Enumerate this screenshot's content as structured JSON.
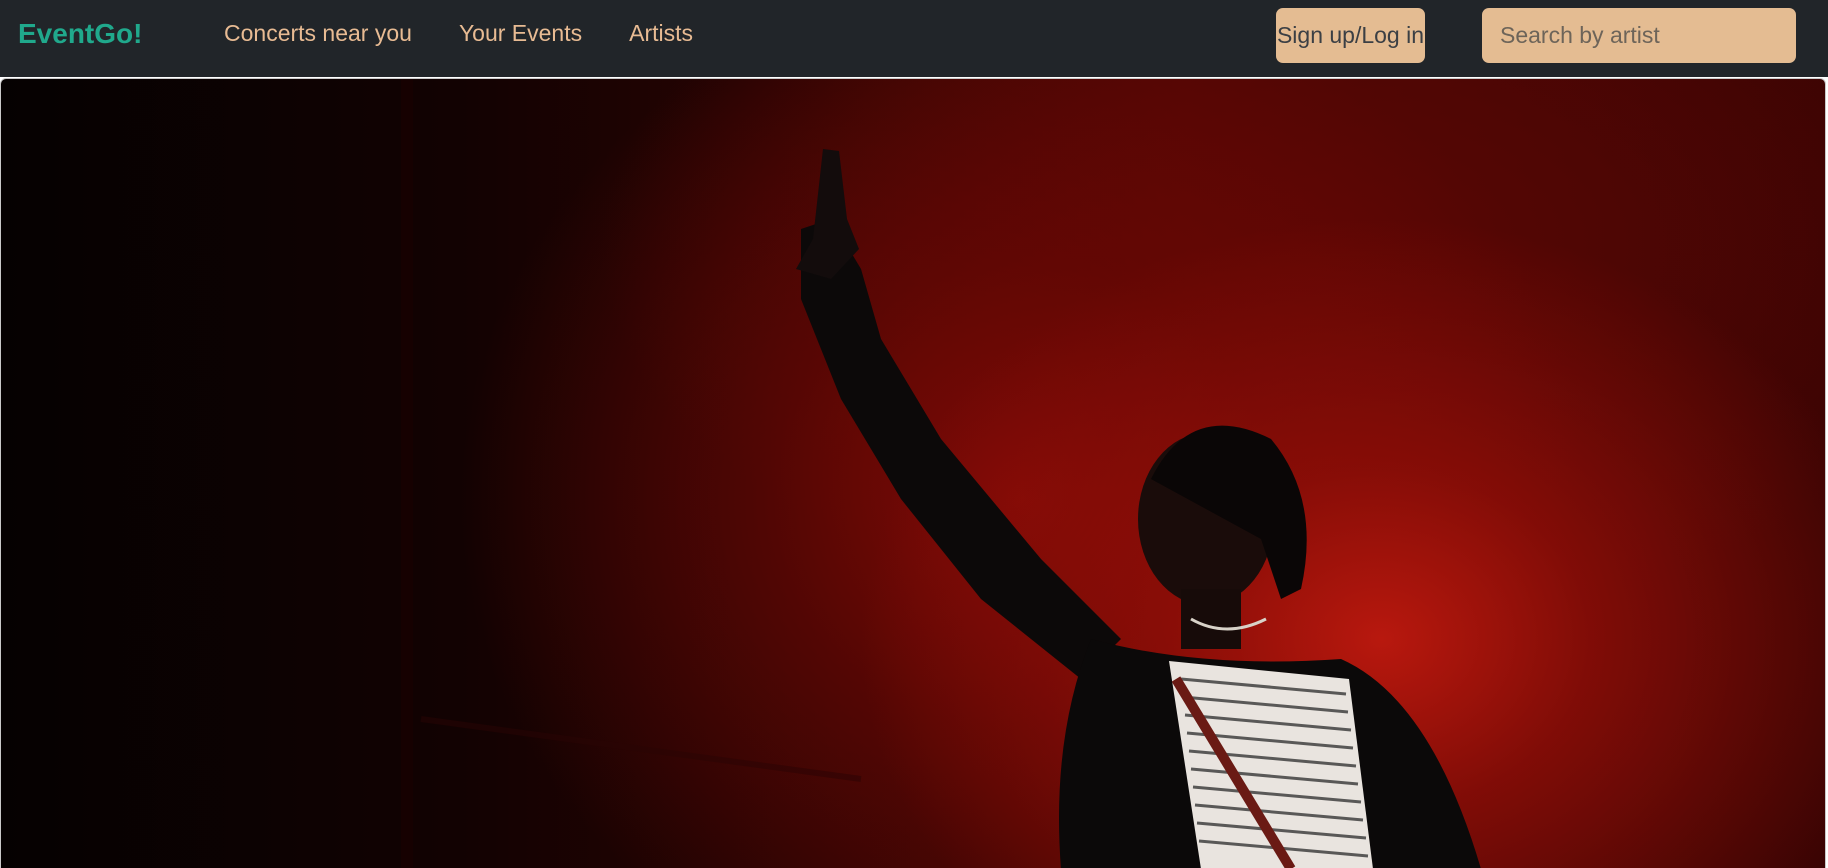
{
  "navbar": {
    "brand": "EventGo!",
    "links": [
      {
        "label": "Concerts near you"
      },
      {
        "label": "Your Events"
      },
      {
        "label": "Artists"
      }
    ],
    "auth_label": "Sign up/Log in",
    "search": {
      "placeholder": "Search by artist",
      "value": ""
    }
  },
  "hero": {
    "image_subject": "performer-on-stage-red-smoke"
  },
  "colors": {
    "navbar_bg": "#212529",
    "brand": "#20a98c",
    "nav_link": "#e8bb93",
    "button_bg": "#e4bc92"
  }
}
